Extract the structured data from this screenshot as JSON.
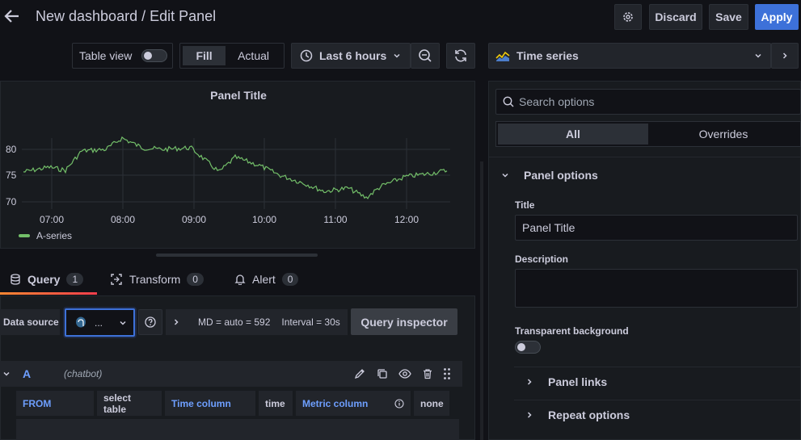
{
  "header": {
    "breadcrumb": "New dashboard / Edit Panel",
    "discard": "Discard",
    "save": "Save",
    "apply": "Apply"
  },
  "toolbar": {
    "table_view": "Table view",
    "fill": "Fill",
    "actual": "Actual",
    "time_range": "Last 6 hours"
  },
  "viz_picker": {
    "label": "Time series"
  },
  "panel": {
    "title": "Panel Title",
    "legend": "A-series",
    "y_ticks": [
      "80",
      "75",
      "70"
    ],
    "x_ticks": [
      "07:00",
      "08:00",
      "09:00",
      "10:00",
      "11:00",
      "12:00"
    ],
    "series_color": "#73bf69"
  },
  "query_tabs": [
    {
      "label": "Query",
      "count": "1"
    },
    {
      "label": "Transform",
      "count": "0"
    },
    {
      "label": "Alert",
      "count": "0"
    }
  ],
  "datasource": {
    "label": "Data source",
    "value": "...",
    "md": "MD = auto = 592",
    "interval": "Interval = 30s",
    "inspector": "Query inspector"
  },
  "query_row": {
    "ref": "A",
    "name": "(chatbot)",
    "from": "FROM",
    "table": "select table",
    "time_col_label": "Time column",
    "time_col": "time",
    "metric_col_label": "Metric column",
    "metric_col": "none"
  },
  "options": {
    "search_placeholder": "Search options",
    "tab_all": "All",
    "tab_overrides": "Overrides",
    "section": "Panel options",
    "title_label": "Title",
    "title_value": "Panel Title",
    "description_label": "Description",
    "transparent_label": "Transparent background",
    "panel_links": "Panel links",
    "repeat_options": "Repeat options"
  },
  "colors": {
    "accent": "#3d71d9",
    "tab_underline": "#f55f3e",
    "series": "#73bf69"
  }
}
